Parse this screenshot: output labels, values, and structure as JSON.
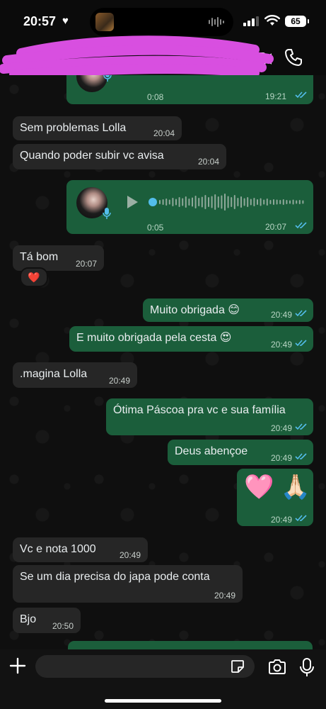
{
  "status_bar": {
    "time": "20:57",
    "battery": "65"
  },
  "messages": [
    {
      "id": "m0",
      "dir": "out",
      "type": "voice",
      "duration": "0:08",
      "time": "19:21"
    },
    {
      "id": "m1",
      "dir": "in",
      "text": "Sem problemas Lolla",
      "time": "20:04"
    },
    {
      "id": "m2",
      "dir": "in",
      "text": "Quando poder subir vc avisa",
      "time": "20:04"
    },
    {
      "id": "m3",
      "dir": "out",
      "type": "voice",
      "duration": "0:05",
      "time": "20:07"
    },
    {
      "id": "m4",
      "dir": "in",
      "text": "Tá bom",
      "time": "20:07",
      "reaction": "❤️"
    },
    {
      "id": "m5",
      "dir": "out",
      "text": "Muito obrigada 😊",
      "time": "20:49"
    },
    {
      "id": "m6",
      "dir": "out",
      "text": "E muito obrigada pela cesta 😍",
      "time": "20:49"
    },
    {
      "id": "m7",
      "dir": "in",
      "text": ".magina Lolla",
      "time": "20:49"
    },
    {
      "id": "m8",
      "dir": "out",
      "text": "Ótima Páscoa pra vc e sua família",
      "time": "20:49"
    },
    {
      "id": "m9",
      "dir": "out",
      "text": "Deus abençoe",
      "time": "20:49"
    },
    {
      "id": "m10",
      "dir": "out",
      "text": "🩷 🙏🏻",
      "time": "20:49"
    },
    {
      "id": "m11",
      "dir": "in",
      "text": "Vc e nota 1000",
      "time": "20:49"
    },
    {
      "id": "m12",
      "dir": "in",
      "text": "Se um dia precisa do japa pode conta",
      "time": "20:49"
    },
    {
      "id": "m13",
      "dir": "in",
      "text": "Bjo",
      "time": "20:50"
    }
  ],
  "colors": {
    "incoming": "#262626",
    "outgoing": "#1b5e3b",
    "read_ticks": "#53bdeb"
  }
}
